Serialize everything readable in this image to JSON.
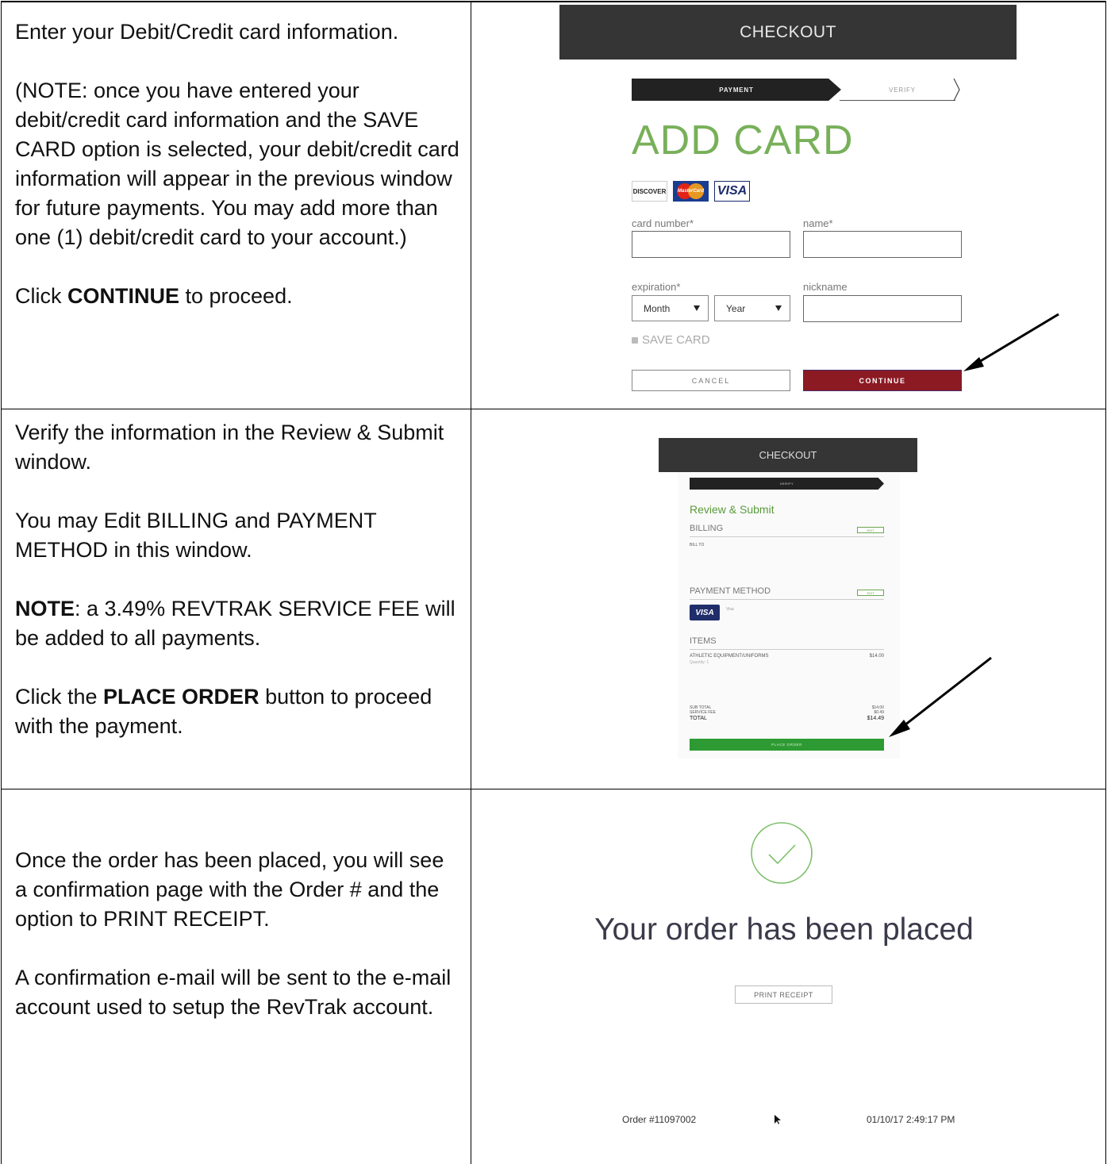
{
  "rows": [
    {
      "paragraphs": [
        {
          "text": "Enter your Debit/Credit card information."
        },
        {
          "text": "(NOTE: once you have entered your debit/credit card information and the SAVE CARD option is selected, your debit/credit card information will appear in the previous window for future payments. You may add more than one (1) debit/credit card to your account.)"
        },
        {
          "pre": "Click ",
          "bold": "CONTINUE",
          "post": " to proceed."
        }
      ]
    },
    {
      "paragraphs": [
        {
          "text": "Verify the information in the Review & Submit window."
        },
        {
          "text": "You may Edit BILLING and PAYMENT METHOD in this window."
        },
        {
          "pre": "",
          "bold": "NOTE",
          "post": ": a 3.49% REVTRAK SERVICE FEE will be added to all payments."
        },
        {
          "pre": "Click the ",
          "bold": "PLACE ORDER",
          "post": " button to proceed with the payment."
        }
      ]
    },
    {
      "paragraphs": [
        {
          "text": "Once the order has been placed, you will see a confirmation page with the Order # and the option to PRINT RECEIPT."
        },
        {
          "text": "A confirmation e-mail will be sent to the e-mail account used to setup the RevTrak account."
        }
      ]
    }
  ],
  "add_card": {
    "header": "CHECKOUT",
    "step_payment": "PAYMENT",
    "step_verify": "VERIFY",
    "title": "ADD CARD",
    "logos": {
      "discover": "DISCOVER",
      "mastercard": "MasterCard",
      "visa": "VISA"
    },
    "card_number_label": "card number*",
    "name_label": "name*",
    "expiration_label": "expiration*",
    "nickname_label": "nickname",
    "month_value": "Month",
    "year_value": "Year",
    "save_card": "SAVE CARD",
    "cancel": "CANCEL",
    "continue": "CONTINUE"
  },
  "review": {
    "header": "CHECKOUT",
    "step_verify": "VERIFY",
    "title": "Review & Submit",
    "billing": "BILLING",
    "edit": "EDIT",
    "bill_to": "BILL TO",
    "payment_method": "PAYMENT METHOD",
    "visa_logo": "VISA",
    "visa_text": "Visa",
    "items": "ITEMS",
    "item_name": "ATHLETIC EQUIPMENT/UNIFORMS",
    "item_price": "$14.00",
    "item_quantity": "Quantity: 1",
    "subtotal_label": "SUB TOTAL",
    "subtotal_value": "$14.00",
    "service_fee_label": "SERVICE FEE",
    "service_fee_value": "$0.49",
    "total_label": "TOTAL",
    "total_value": "$14.49",
    "place_order": "PLACE ORDER"
  },
  "confirmation": {
    "title": "Your order has been placed",
    "print_receipt": "PRINT RECEIPT",
    "order_number": "Order #11097002",
    "order_datetime": "01/10/17 2:49:17 PM"
  },
  "colors": {
    "header_dark": "#353535",
    "add_card_green": "#78b05a",
    "continue_red": "#8b1a23",
    "place_order_green": "#2e9a33",
    "check_green": "#7cbf6a"
  }
}
